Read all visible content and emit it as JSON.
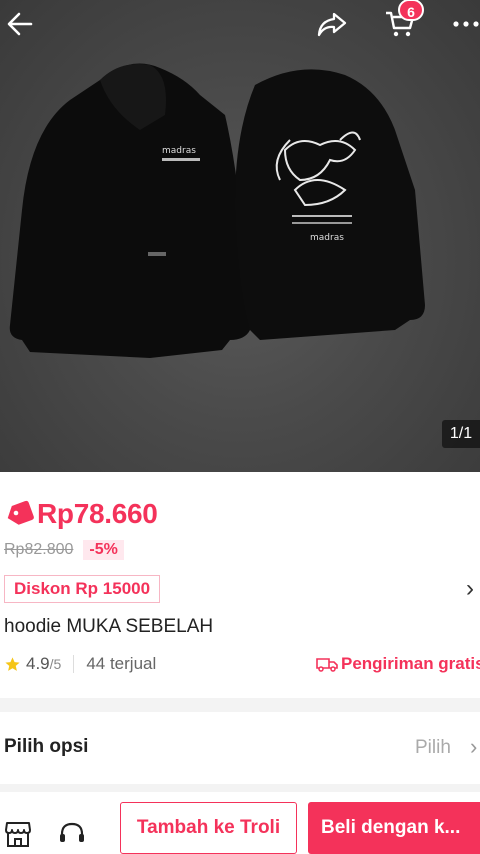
{
  "header": {
    "cart_count": "6",
    "image_counter": "1/1"
  },
  "product": {
    "price": "Rp78.660",
    "original_price": "Rp82.800",
    "discount_percent": "-5%",
    "voucher": "Diskon Rp 15000",
    "title": "hoodie MUKA SEBELAH",
    "rating": "4.9",
    "rating_max": "/5",
    "sold": "44 terjual",
    "shipping": "Pengiriman gratis"
  },
  "options": {
    "label": "Pilih opsi",
    "value": "Pilih"
  },
  "bottom_bar": {
    "add_to_cart": "Tambah ke Troli",
    "buy_now": "Beli dengan k..."
  },
  "colors": {
    "accent": "#f4325a",
    "star": "#f5c518"
  },
  "icons": [
    "back-icon",
    "share-icon",
    "cart-icon",
    "more-icon",
    "price-tag-icon",
    "star-icon",
    "truck-icon",
    "chevron-right-icon",
    "shop-icon",
    "customer-service-icon"
  ]
}
